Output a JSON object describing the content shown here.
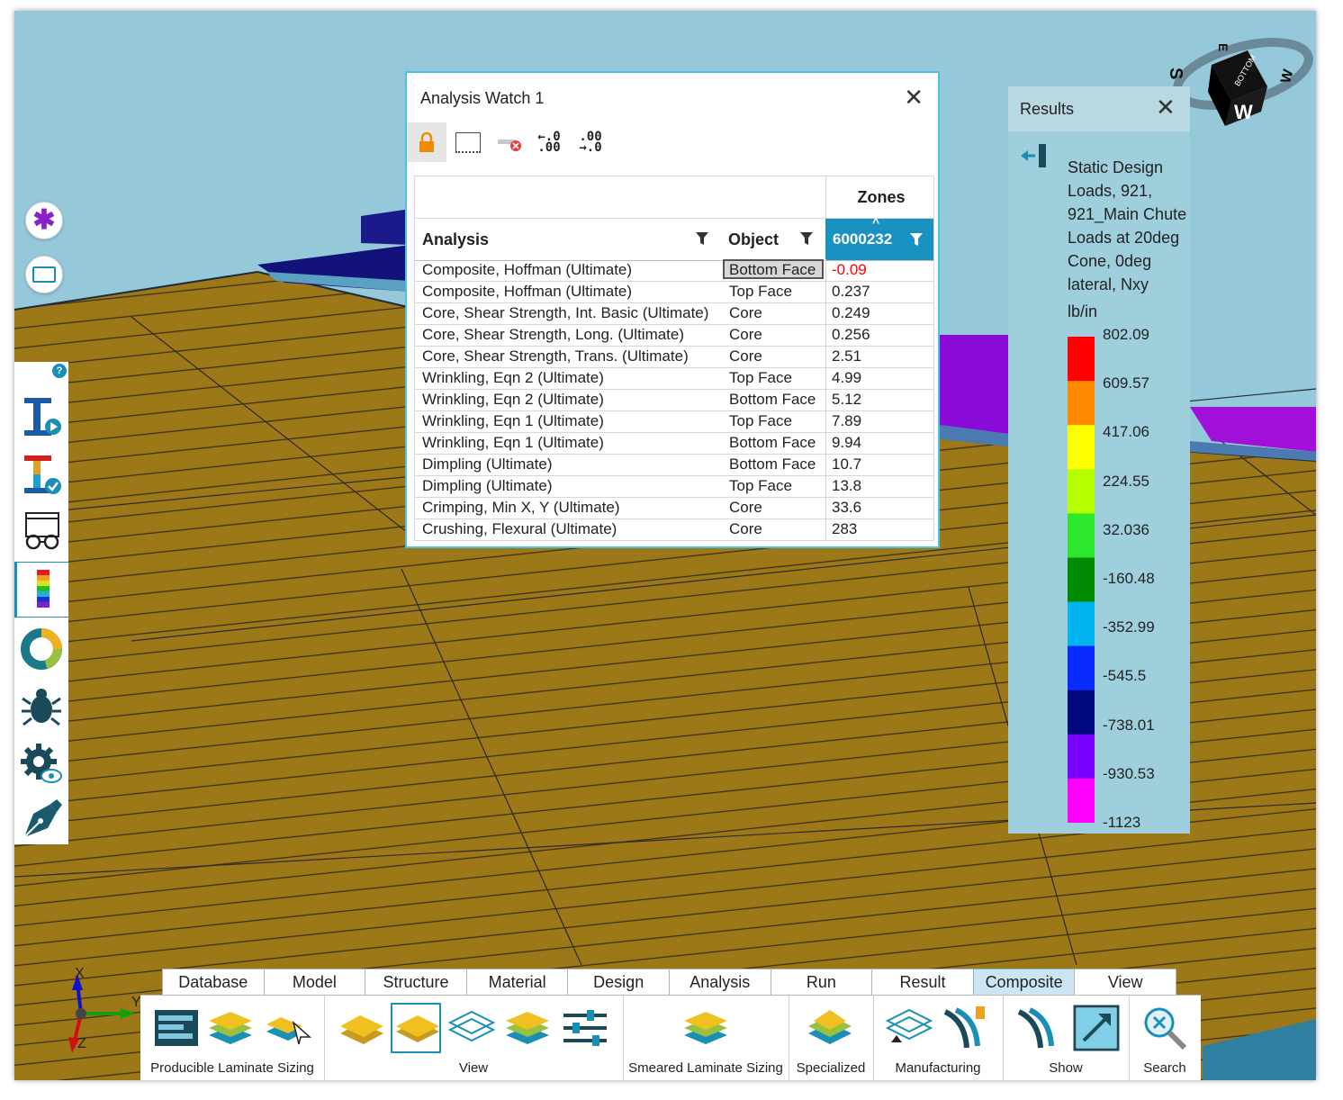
{
  "left_tools": {
    "top_buttons": [
      {
        "icon": "asterisk-icon"
      },
      {
        "icon": "rectangle-icon"
      }
    ],
    "help_icon": "question-icon",
    "side_buttons": [
      {
        "icon": "laminate-thickness-run-icon"
      },
      {
        "icon": "laminate-check-icon"
      },
      {
        "icon": "glasses-view-icon"
      },
      {
        "icon": "contour-legend-icon",
        "active": true
      },
      {
        "icon": "donut-chart-icon"
      },
      {
        "icon": "bug-icon"
      },
      {
        "icon": "gear-eye-icon"
      },
      {
        "icon": "pen-nib-icon"
      }
    ]
  },
  "analysis_watch": {
    "title": "Analysis Watch 1",
    "toolbar": [
      {
        "icon": "lock-icon",
        "label": ""
      },
      {
        "icon": "window-icon",
        "label": ""
      },
      {
        "icon": "clear-icon",
        "label": ""
      },
      {
        "icon": "decrease-decimals-icon",
        "label": "←.0\n.00"
      },
      {
        "icon": "increase-decimals-icon",
        "label": ".00\n→.0"
      }
    ],
    "group_header": "Zones",
    "columns": {
      "analysis": "Analysis",
      "object": "Object",
      "zone": "6000232"
    },
    "rows": [
      {
        "analysis": "Composite, Hoffman (Ultimate)",
        "object": "Bottom Face",
        "value": "-0.09",
        "negative": true,
        "selected": true
      },
      {
        "analysis": "Composite, Hoffman (Ultimate)",
        "object": "Top Face",
        "value": "0.237"
      },
      {
        "analysis": "Core, Shear Strength, Int. Basic (Ultimate)",
        "object": "Core",
        "value": "0.249"
      },
      {
        "analysis": "Core, Shear Strength, Long. (Ultimate)",
        "object": "Core",
        "value": "0.256"
      },
      {
        "analysis": "Core, Shear Strength, Trans. (Ultimate)",
        "object": "Core",
        "value": "2.51"
      },
      {
        "analysis": "Wrinkling, Eqn 2 (Ultimate)",
        "object": "Top Face",
        "value": "4.99"
      },
      {
        "analysis": "Wrinkling, Eqn 2 (Ultimate)",
        "object": "Bottom Face",
        "value": "5.12"
      },
      {
        "analysis": "Wrinkling, Eqn 1 (Ultimate)",
        "object": "Top Face",
        "value": "7.89"
      },
      {
        "analysis": "Wrinkling, Eqn 1 (Ultimate)",
        "object": "Bottom Face",
        "value": "9.94"
      },
      {
        "analysis": "Dimpling (Ultimate)",
        "object": "Bottom Face",
        "value": "10.7"
      },
      {
        "analysis": "Dimpling (Ultimate)",
        "object": "Top Face",
        "value": "13.8"
      },
      {
        "analysis": "Crimping, Min X, Y (Ultimate)",
        "object": "Core",
        "value": "33.6"
      },
      {
        "analysis": "Crushing, Flexural (Ultimate)",
        "object": "Core",
        "value": "283"
      }
    ]
  },
  "results": {
    "title": "Results",
    "description_lines": [
      "Static Design",
      "Loads, 921,",
      "921_Main Chute",
      "Loads at 20deg",
      "Cone, 0deg",
      "lateral, Nxy"
    ],
    "units": "lb/in",
    "legend_labels": [
      "802.09",
      "609.57",
      "417.06",
      "224.55",
      "32.036",
      "-160.48",
      "-352.99",
      "-545.5",
      "-738.01",
      "-930.53",
      "-1123"
    ],
    "legend_colors": [
      "#ff0000",
      "#ff8a00",
      "#ffff00",
      "#b6ff00",
      "#2ee82e",
      "#008a00",
      "#00b4f0",
      "#0a2bff",
      "#000a7e",
      "#7a00ff",
      "#ff00ff"
    ]
  },
  "view_cube": {
    "faces": [
      "BOTTOM",
      "W"
    ],
    "compass": [
      "S",
      "E",
      "W"
    ]
  },
  "triad": {
    "x": "X",
    "y": "Y",
    "z": "Z"
  },
  "ribbon": {
    "tabs": [
      "Database",
      "Model",
      "Structure",
      "Material",
      "Design",
      "Analysis",
      "Run",
      "Result",
      "Composite",
      "View"
    ],
    "active_tab": "Composite",
    "groups": [
      "Producible Laminate Sizing",
      "View",
      "Smeared Laminate Sizing",
      "Specialized",
      "Manufacturing",
      "Show",
      "Search"
    ]
  },
  "colors": {
    "accent": "#1a92c1",
    "panel_surface": "#9c7818",
    "sky": "#95c9d9",
    "negative_value": "#ff0000"
  }
}
